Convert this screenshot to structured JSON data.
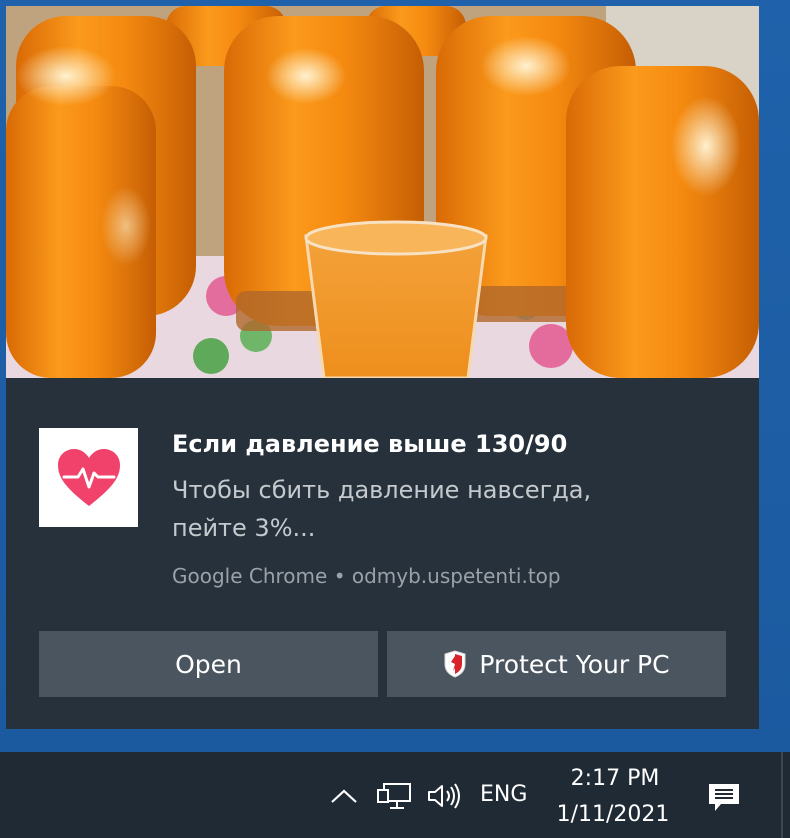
{
  "notification": {
    "title": "Если давление выше 130/90",
    "body": "Чтобы сбить давление навсегда, пейте 3%...",
    "attribution": "Google Chrome • odmyb.uspetenti.top",
    "app_icon": "heart-pulse-icon",
    "hero_image": "orange-juice-jars-photo",
    "buttons": {
      "open_label": "Open",
      "protect_label": "Protect Your PC",
      "protect_icon": "shield-icon"
    }
  },
  "taskbar": {
    "tray_icons": [
      "chevron-up-icon",
      "network-icon",
      "volume-icon"
    ],
    "language": "ENG",
    "time": "2:17 PM",
    "date": "1/11/2021",
    "action_center_icon": "action-center-icon"
  },
  "colors": {
    "desktop": "#1f62ab",
    "toast_bg": "#27313b",
    "button_bg": "#4b555f",
    "heart": "#f0426a"
  }
}
